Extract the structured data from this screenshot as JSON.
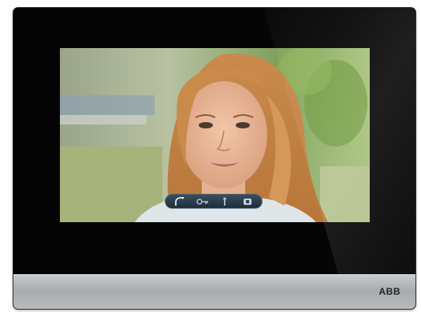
{
  "device": {
    "brand": "ABB",
    "type": "video-intercom-panel"
  },
  "video_call": {
    "controls": [
      {
        "name": "handset-icon",
        "action": "answer"
      },
      {
        "name": "door-key-icon",
        "action": "unlock-door"
      },
      {
        "name": "light-icon",
        "action": "switch-light"
      },
      {
        "name": "speaker-icon",
        "action": "audio"
      }
    ]
  },
  "colors": {
    "frame": "#050505",
    "control_bar": "#2b3c4c",
    "strip": "#b5b7b9"
  }
}
